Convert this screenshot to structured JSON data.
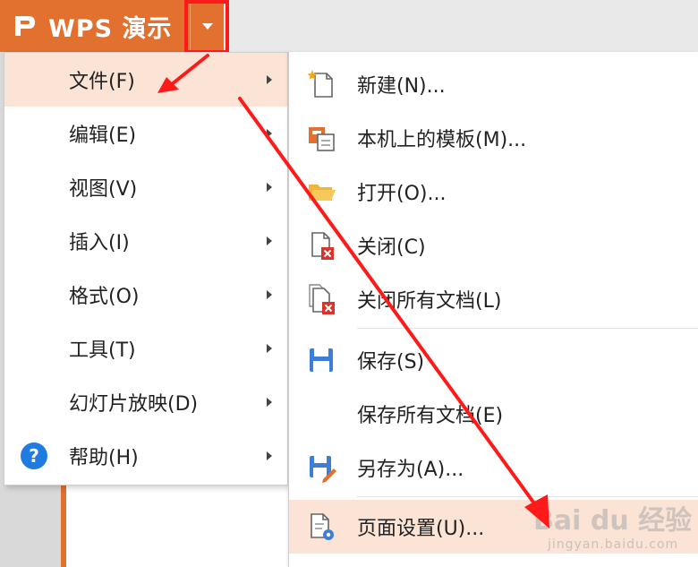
{
  "app": {
    "brand_mark": "P",
    "title": "WPS 演示"
  },
  "main_menu": {
    "items": [
      {
        "label": "文件(F)",
        "has_submenu": true,
        "active": true
      },
      {
        "label": "编辑(E)",
        "has_submenu": true,
        "active": false
      },
      {
        "label": "视图(V)",
        "has_submenu": true,
        "active": false
      },
      {
        "label": "插入(I)",
        "has_submenu": true,
        "active": false
      },
      {
        "label": "格式(O)",
        "has_submenu": true,
        "active": false
      },
      {
        "label": "工具(T)",
        "has_submenu": true,
        "active": false
      },
      {
        "label": "幻灯片放映(D)",
        "has_submenu": true,
        "active": false
      },
      {
        "label": "帮助(H)",
        "has_submenu": true,
        "active": false,
        "icon": "help-icon"
      }
    ]
  },
  "file_submenu": {
    "items": [
      {
        "label": "新建(N)...",
        "icon": "new-document-icon"
      },
      {
        "label": "本机上的模板(M)...",
        "icon": "template-icon"
      },
      {
        "label": "打开(O)...",
        "icon": "folder-open-icon"
      },
      {
        "label": "关闭(C)",
        "icon": "close-document-icon"
      },
      {
        "label": "关闭所有文档(L)",
        "icon": "close-all-documents-icon"
      },
      {
        "label": "保存(S)",
        "icon": "save-icon"
      },
      {
        "label": "保存所有文档(E)",
        "icon": ""
      },
      {
        "label": "另存为(A)...",
        "icon": "save-as-icon"
      },
      {
        "label": "页面设置(U)...",
        "icon": "page-setup-icon",
        "active": true
      }
    ]
  },
  "watermark": {
    "main": "Bai du 经验",
    "sub": "jingyan.baidu.com"
  },
  "colors": {
    "brand": "#e2702f",
    "highlight": "#fbe3d5",
    "annotation": "#ff1a1a",
    "help_icon": "#1f7be0"
  }
}
